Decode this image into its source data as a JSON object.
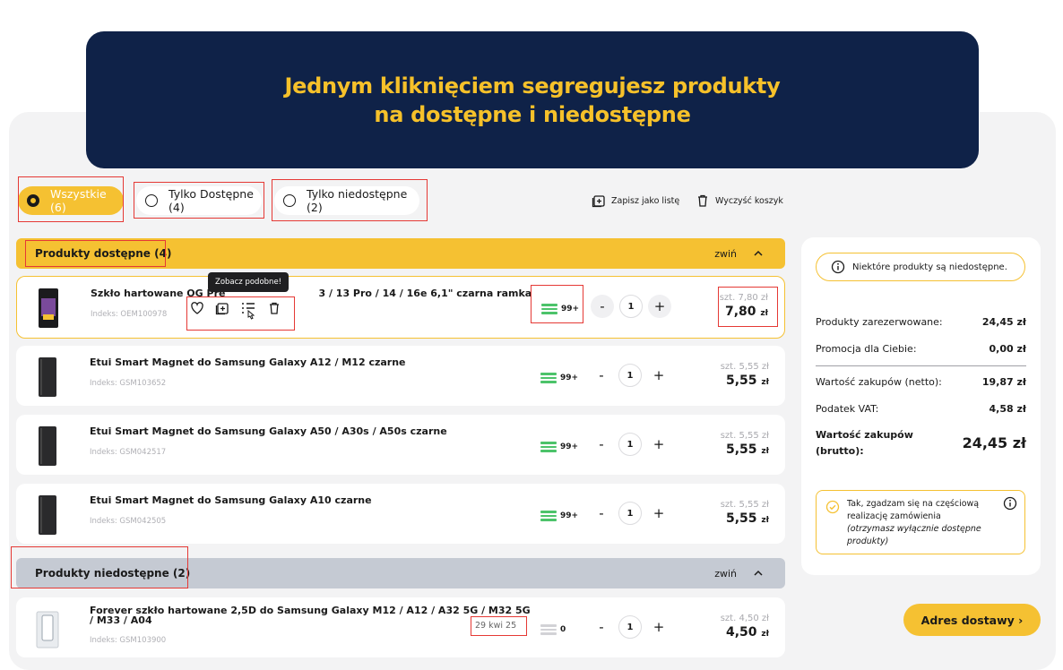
{
  "banner": {
    "line1": "Jednym kliknięciem segregujesz produkty",
    "line2": "na dostępne i niedostępne"
  },
  "filters": {
    "all": "Wszystkie (6)",
    "available": "Tylko Dostępne (4)",
    "unavailable": "Tylko niedostępne (2)"
  },
  "toolbar": {
    "save_list": "Zapisz jako listę",
    "clear_cart": "Wyczyść koszyk"
  },
  "sections": {
    "available": {
      "title": "Produkty dostępne (4)",
      "collapse": "zwiń"
    },
    "unavailable": {
      "title": "Produkty niedostępne (2)",
      "collapse": "zwiń"
    }
  },
  "tooltip": "Zobacz podobne!",
  "products": [
    {
      "name": "Szkło hartowane OG Premium ... 13 / 13 Pro / 14 / 16e 6,1\" czarna ramka",
      "name_left": "Szkło hartowane OG Pre",
      "name_right": "3 / 13 Pro / 14 / 16e 6,1\" czarna ramka",
      "index": "Indeks: OEM100978",
      "stock": "99+",
      "qty": "1",
      "unit_price": "szt. 7,80 zł",
      "price": "7,80",
      "currency": "zł"
    },
    {
      "name": "Etui Smart Magnet do Samsung Galaxy A12 / M12 czarne",
      "index": "Indeks: GSM103652",
      "stock": "99+",
      "qty": "1",
      "unit_price": "szt. 5,55 zł",
      "price": "5,55",
      "currency": "zł"
    },
    {
      "name": "Etui Smart Magnet do Samsung Galaxy A50 / A30s / A50s czarne",
      "index": "Indeks: GSM042517",
      "stock": "99+",
      "qty": "1",
      "unit_price": "szt. 5,55 zł",
      "price": "5,55",
      "currency": "zł"
    },
    {
      "name": "Etui Smart Magnet do Samsung Galaxy A10 czarne",
      "index": "Indeks: GSM042505",
      "stock": "99+",
      "qty": "1",
      "unit_price": "szt. 5,55 zł",
      "price": "5,55",
      "currency": "zł"
    },
    {
      "name_line1": "Forever szkło hartowane 2,5D do Samsung Galaxy M12 / A12 / A32 5G / M32 5G",
      "name_line2": "/ M33 / A04",
      "index": "Indeks: GSM103900",
      "date": "29 kwi 25",
      "stock": "0",
      "qty": "1",
      "unit_price": "szt. 4,50 zł",
      "price": "4,50",
      "currency": "zł"
    }
  ],
  "summary": {
    "note": "Niektóre produkty są niedostępne.",
    "reserved_label": "Produkty zarezerwowane:",
    "reserved_value": "24,45 zł",
    "promo_label": "Promocja dla Ciebie:",
    "promo_value": "0,00 zł",
    "net_label": "Wartość zakupów (netto):",
    "net_value": "19,87 zł",
    "vat_label": "Podatek VAT:",
    "vat_value": "4,58 zł",
    "gross_label_1": "Wartość zakupów",
    "gross_label_2": "(brutto):",
    "gross_value": "24,45 zł",
    "consent_1": "Tak, zgadzam się na częściową realizację zamówienia",
    "consent_2": "(otrzymasz wyłącznie dostępne produkty)"
  },
  "cta": "Adres dostawy ›",
  "colors": {
    "navy": "#0f2248",
    "accent": "#f5c132",
    "stock_ok": "#4cc36a",
    "highlight": "#e53935"
  }
}
